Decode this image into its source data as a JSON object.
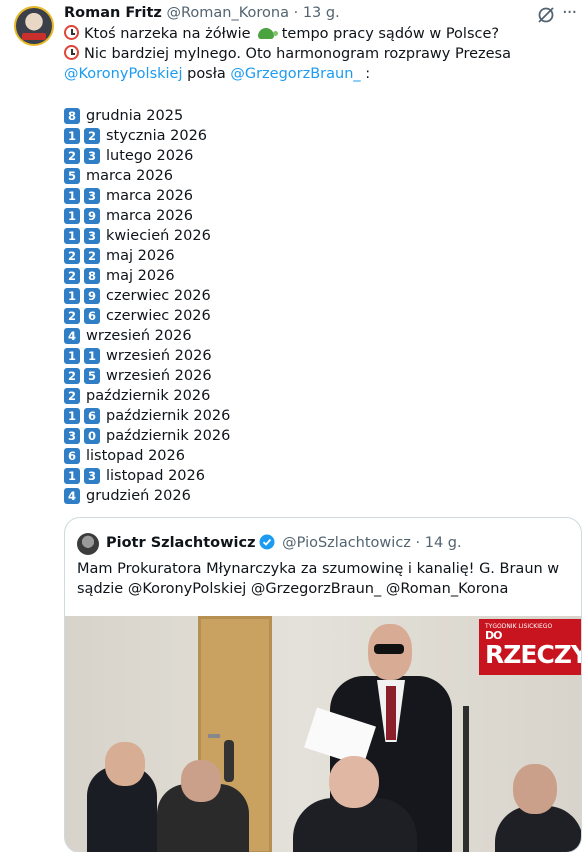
{
  "tweet": {
    "author_name": "Roman Fritz",
    "author_handle": "@Roman_Korona",
    "separator": "·",
    "time": "13 g.",
    "more_label": "···",
    "line1_text": "Ktoś narzeka na żółwie",
    "line1_text_after": "tempo pracy sądów w Polsce?",
    "line2_text": "Nic bardziej mylnego. Oto harmonogram rozprawy Prezesa",
    "line3_mention1": "@KoronyPolskiej",
    "line3_middle": "posła",
    "line3_mention2": "@GrzegorzBraun_",
    "line3_end": ":",
    "dates": [
      {
        "digits": [
          "8"
        ],
        "label": "grudnia 2025"
      },
      {
        "digits": [
          "1",
          "2"
        ],
        "label": "stycznia 2026"
      },
      {
        "digits": [
          "2",
          "3"
        ],
        "label": "lutego 2026"
      },
      {
        "digits": [
          "5"
        ],
        "label": "marca 2026"
      },
      {
        "digits": [
          "1",
          "3"
        ],
        "label": "marca 2026"
      },
      {
        "digits": [
          "1",
          "9"
        ],
        "label": "marca 2026"
      },
      {
        "digits": [
          "1",
          "3"
        ],
        "label": "kwiecień 2026"
      },
      {
        "digits": [
          "2",
          "2"
        ],
        "label": "maj 2026"
      },
      {
        "digits": [
          "2",
          "8"
        ],
        "label": "maj 2026"
      },
      {
        "digits": [
          "1",
          "9"
        ],
        "label": "czerwiec 2026"
      },
      {
        "digits": [
          "2",
          "6"
        ],
        "label": "czerwiec 2026"
      },
      {
        "digits": [
          "4"
        ],
        "label": "wrzesień 2026"
      },
      {
        "digits": [
          "1",
          "1"
        ],
        "label": "wrzesień 2026"
      },
      {
        "digits": [
          "2",
          "5"
        ],
        "label": "wrzesień 2026"
      },
      {
        "digits": [
          "2"
        ],
        "label": "październik 2026"
      },
      {
        "digits": [
          "1",
          "6"
        ],
        "label": "październik 2026"
      },
      {
        "digits": [
          "3",
          "0"
        ],
        "label": "październik 2026"
      },
      {
        "digits": [
          "6"
        ],
        "label": "listopad 2026"
      },
      {
        "digits": [
          "1",
          "3"
        ],
        "label": "listopad 2026"
      },
      {
        "digits": [
          "4"
        ],
        "label": "grudzień 2026"
      }
    ]
  },
  "quote": {
    "author_name": "Piotr Szlachtowicz",
    "author_handle": "@PioSzlachtowicz",
    "separator": "·",
    "time": "14 g.",
    "text_line1": "Mam Prokuratora Młynarczyka za szumowinę i kanalię! G. Braun w",
    "text_line2": "sądzie @KoronyPolskiej @GrzegorzBraun_ @Roman_Korona",
    "photo_logo_small": "TYGODNIK LISICKIEGO",
    "photo_logo_top": "DO",
    "photo_logo_big": "RZECZY"
  },
  "colors": {
    "text": "#0f1419",
    "secondary": "#536471",
    "link": "#1d9bf0",
    "keycap": "#2f7ec6",
    "logo_red": "#c8141e"
  }
}
